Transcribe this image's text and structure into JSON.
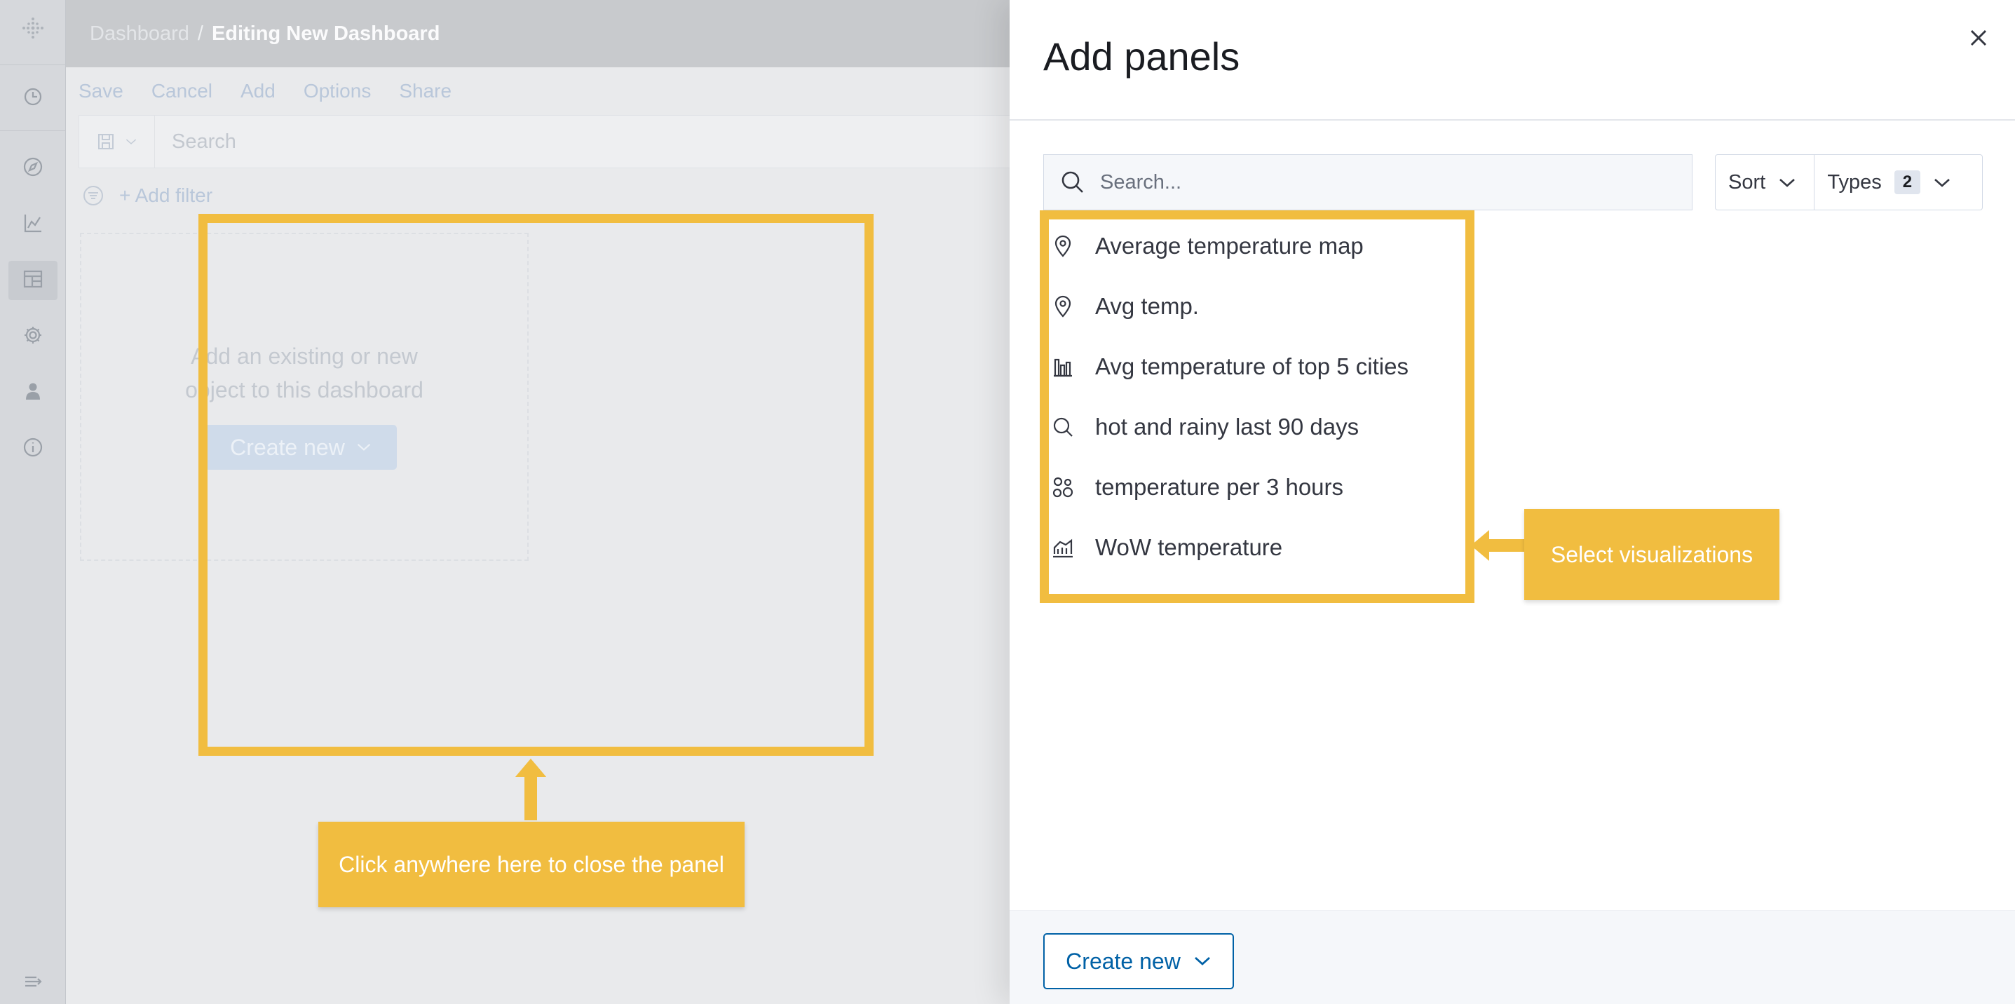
{
  "nav": {
    "icons": [
      "clock-icon",
      "compass-icon",
      "visualize-icon",
      "dashboard-icon",
      "gear-icon",
      "user-icon",
      "info-icon",
      "collapse-icon"
    ]
  },
  "dashboard": {
    "breadcrumb_root": "Dashboard",
    "breadcrumb_sep": "/",
    "breadcrumb_current": "Editing New Dashboard",
    "menu": [
      "Save",
      "Cancel",
      "Add",
      "Options",
      "Share"
    ],
    "search_placeholder": "Search",
    "add_filter": "+ Add filter",
    "empty_line1": "Add an existing or new",
    "empty_line2": "object to this dashboard",
    "create_new": "Create new"
  },
  "flyout": {
    "title": "Add panels",
    "search_placeholder": "Search...",
    "sort_label": "Sort",
    "types_label": "Types",
    "types_count": "2",
    "items": [
      {
        "label": "Average temperature map",
        "icon": "map-pin-icon"
      },
      {
        "label": "Avg temp.",
        "icon": "map-pin-icon"
      },
      {
        "label": "Avg temperature of top 5 cities",
        "icon": "bar-chart-icon"
      },
      {
        "label": "hot and rainy last 90 days",
        "icon": "search-icon"
      },
      {
        "label": "temperature per 3 hours",
        "icon": "bubbles-icon"
      },
      {
        "label": "WoW temperature",
        "icon": "area-chart-icon"
      }
    ],
    "create_new": "Create new"
  },
  "annotations": {
    "left_callout": "Click anywhere here to close the panel",
    "right_callout": "Select visualizations"
  },
  "colors": {
    "highlight": "#f1bd40",
    "primary": "#0061a6",
    "text": "#343741"
  }
}
